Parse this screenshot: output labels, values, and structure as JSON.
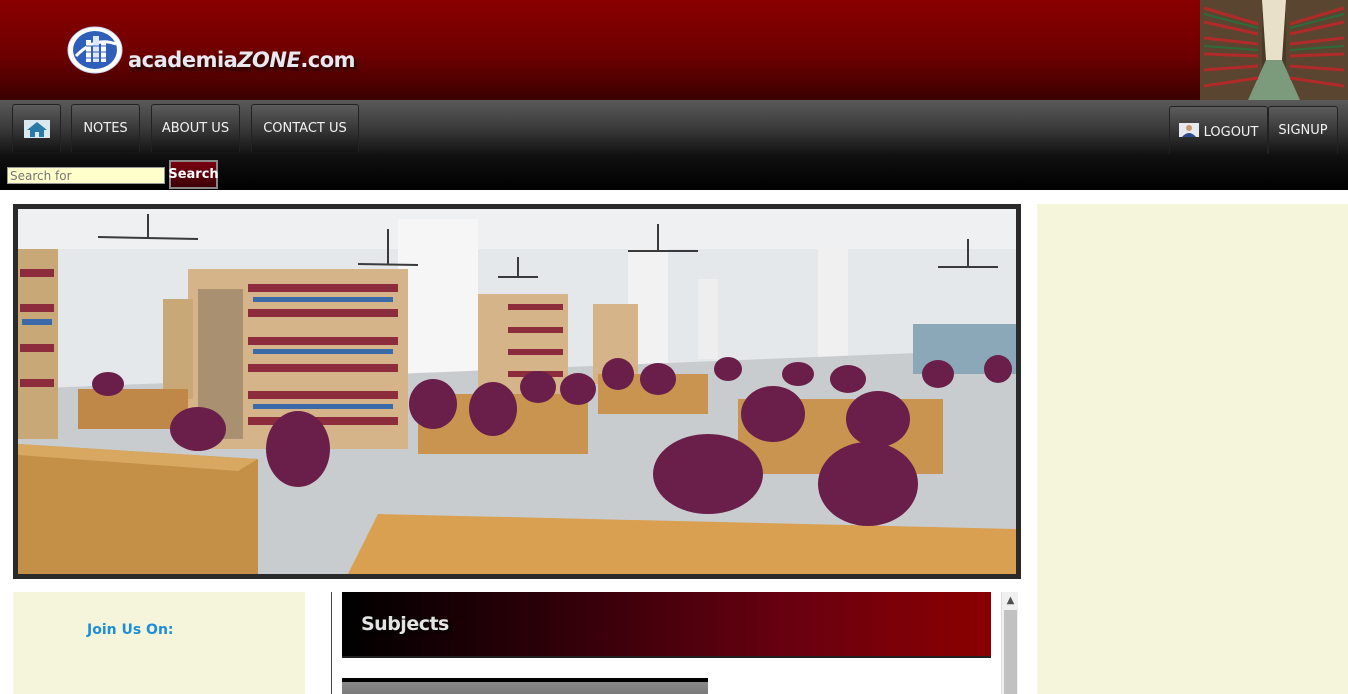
{
  "header": {
    "logo_text": "academia",
    "logo_text_zone": "ZONE",
    "logo_text_suffix": ".com"
  },
  "nav": {
    "home_icon": "home-icon",
    "items": [
      {
        "label": "NOTES"
      },
      {
        "label": "ABOUT US"
      },
      {
        "label": "CONTACT US"
      }
    ],
    "logout_icon": "user-icon",
    "logout_label": "LOGOUT",
    "signup_label": "SIGNUP"
  },
  "search": {
    "placeholder": "Search for",
    "button_label": "Search"
  },
  "left_panel": {
    "join_label": "Join Us On:"
  },
  "main": {
    "subjects_title": "Subjects"
  },
  "colors": {
    "banner": "#8a0000",
    "panel": "#f5f5dc",
    "join_text": "#1c8fd8"
  }
}
